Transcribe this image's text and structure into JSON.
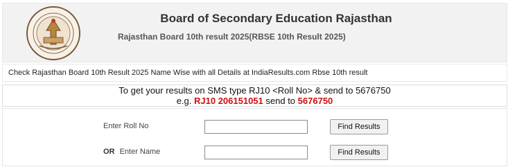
{
  "header": {
    "title": "Board of Secondary Education Rajasthan",
    "subtitle": "Rajasthan Board 10th result 2025(RBSE 10th Result 2025)",
    "logo_icon": "rbse-emblem-icon"
  },
  "info_line": "Check Rajasthan Board 10th Result 2025 Name Wise with all Details at IndiaResults.com Rbse 10th result",
  "sms": {
    "line1": "To get your results on SMS type RJ10 <Roll No> & send to 5676750",
    "prefix": "e.g.",
    "code": "RJ10 206151051",
    "send_to": "send to",
    "number": "5676750"
  },
  "form": {
    "roll": {
      "label": "Enter Roll No",
      "value": "",
      "button": "Find Results"
    },
    "name": {
      "or": "OR",
      "label": "Enter Name",
      "value": "",
      "button": "Find Results"
    }
  },
  "colors": {
    "accent_red": "#cc1111",
    "header_bg": "#f2f2f2"
  }
}
